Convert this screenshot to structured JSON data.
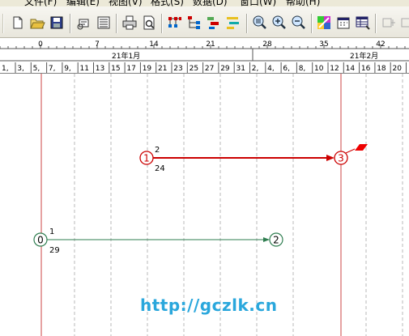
{
  "menu": {
    "items": [
      "文件(F)",
      "编辑(E)",
      "视图(V)",
      "格式(S)",
      "数据(D)",
      "窗口(W)",
      "帮助(H)"
    ]
  },
  "toolbar": {
    "buttons": [
      "new-icon",
      "open-icon",
      "save-icon",
      "link-icon",
      "list-icon",
      "print-icon",
      "print-preview-icon",
      "network-icon",
      "tree-icon",
      "arrange-icon",
      "bars-icon",
      "zoom-fit-icon",
      "zoom-in-icon",
      "zoom-out-icon",
      "color-icon",
      "calendar-icon",
      "table-icon",
      "disabled-icon"
    ]
  },
  "ruler": {
    "top_ticks": [
      "0",
      "7",
      "14",
      "21",
      "28",
      "35",
      "42"
    ],
    "months": [
      "21年1月",
      "21年2月"
    ],
    "days": [
      "1,",
      "3,",
      "5,",
      "7,",
      "9,",
      "11",
      "13",
      "15",
      "17",
      "19",
      "21",
      "23",
      "25",
      "27",
      "29",
      "31",
      "2,",
      "4,",
      "6,",
      "8,",
      "10",
      "12",
      "14",
      "16",
      "18",
      "20"
    ]
  },
  "network": {
    "nodes": [
      {
        "id": "1",
        "above": "2",
        "below": "24",
        "color": "#cc0000"
      },
      {
        "id": "3",
        "above": "",
        "below": "",
        "color": "#cc0000"
      },
      {
        "id": "0",
        "above": "1",
        "below": "29",
        "color": "#2e7d4f"
      },
      {
        "id": "2",
        "above": "",
        "below": "",
        "color": "#2e7d4f"
      }
    ],
    "critical_color": "#cc0000",
    "normal_color": "#2e7d4f"
  },
  "watermark": "http://gczlk.cn"
}
